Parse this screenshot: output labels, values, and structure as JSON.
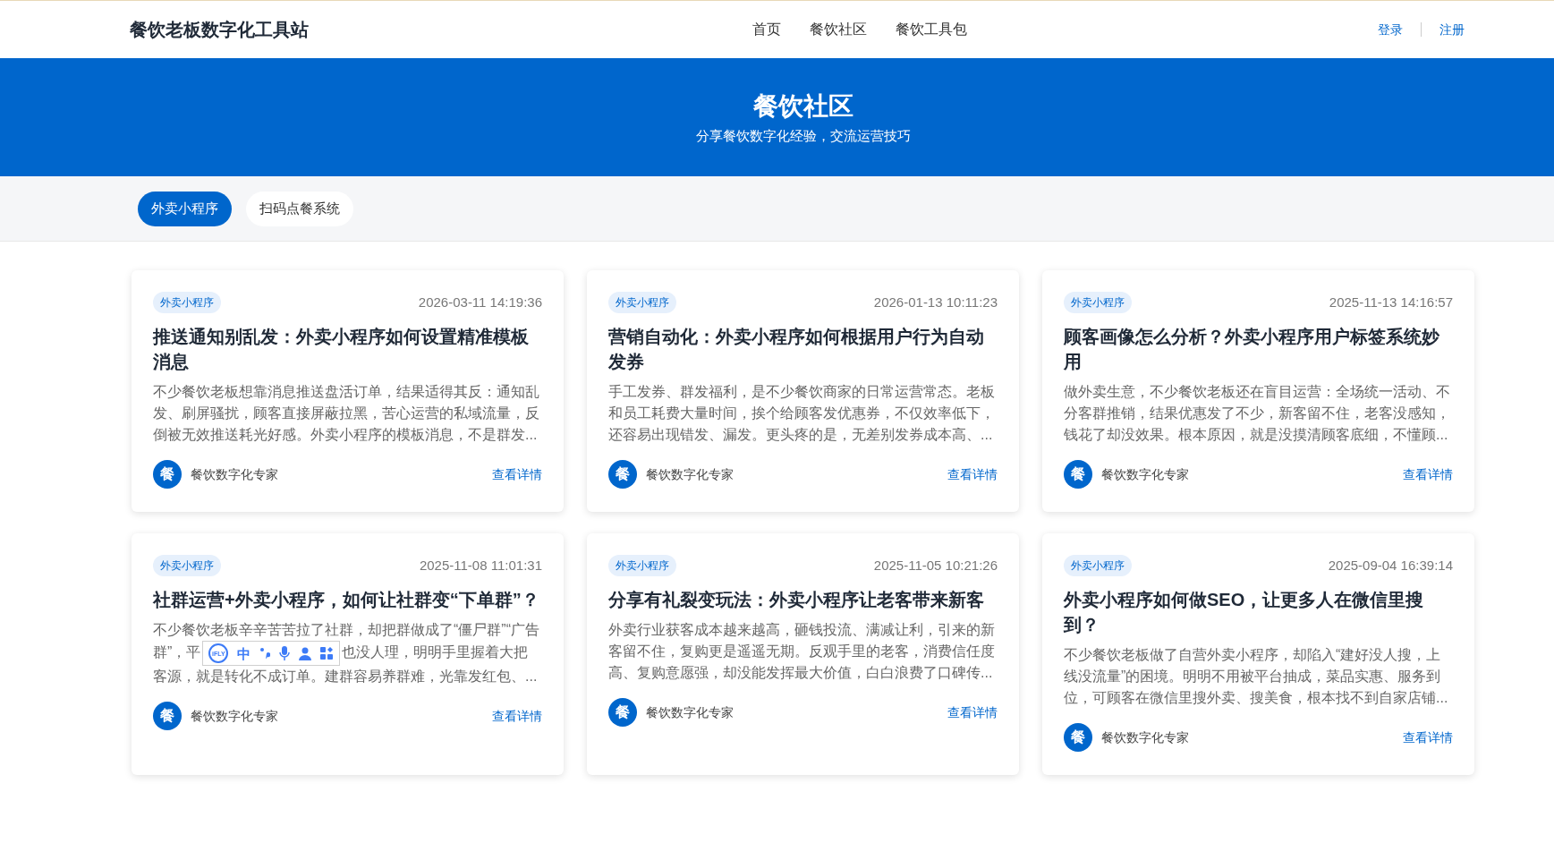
{
  "header": {
    "logo": "餐饮老板数字化工具站",
    "nav": [
      {
        "label": "首页",
        "selected": false
      },
      {
        "label": "餐饮社区",
        "selected": false
      },
      {
        "label": "餐饮工具包",
        "selected": false
      }
    ],
    "auth": [
      "登录",
      "注册"
    ]
  },
  "hero": {
    "title": "餐饮社区",
    "subtitle": "分享餐饮数字化经验，交流运营技巧"
  },
  "filters": [
    {
      "label": "外卖小程序",
      "selected": true
    },
    {
      "label": "扫码点餐系统",
      "selected": false
    }
  ],
  "articles": [
    {
      "tag": "外卖小程序",
      "date": "2026-03-11 14:19:36",
      "title": "推送通知别乱发：外卖小程序如何设置精准模板消息",
      "excerpt": [
        "不少餐饮老板想靠消息推送盘活订单，结果适得其反：通知乱发、刷屏骚扰，顾客直接屏蔽拉黑，苦心运营的私域流量，反倒被无效推送耗光好感。外卖小程序的模板消息，不是群发..."
      ],
      "avatar": "餐",
      "author": "餐饮数字化专家",
      "link": "查看详情"
    },
    {
      "tag": "外卖小程序",
      "date": "2026-01-13 10:11:23",
      "title": "营销自动化：外卖小程序如何根据用户行为自动发券",
      "excerpt": [
        "手工发券、群发福利，是不少餐饮商家的日常运营常态。老板和员工耗费大量时间，挨个给顾客发优惠券，不仅效率低下，还容易出现错发、漏发。更头疼的是，无差别发券成本高、..."
      ],
      "avatar": "餐",
      "author": "餐饮数字化专家",
      "link": "查看详情"
    },
    {
      "tag": "外卖小程序",
      "date": "2025-11-13 14:16:57",
      "title": "顾客画像怎么分析？外卖小程序用户标签系统妙用",
      "excerpt": [
        "做外卖生意，不少餐饮老板还在盲目运营：全场统一活动、不分客群推销，结果优惠发了不少，新客留不住，老客没感知，钱花了却没效果。根本原因，就是没摸清顾客底细，不懂顾..."
      ],
      "avatar": "餐",
      "author": "餐饮数字化专家",
      "link": "查看详情"
    },
    {
      "tag": "外卖小程序",
      "date": "2025-11-08 11:01:31",
      "title": "社群运营+外卖小程序，如何让社群变“下单群”？",
      "excerpt": [
        "不少餐饮老板辛辛苦苦拉了社群，却把群做成了“僵尸群”“广告群”，平",
        "也没人理，明明手里握着大把客源，就是转化不成订单。建群容易养群难，光靠发红包、..."
      ],
      "avatar": "餐",
      "author": "餐饮数字化专家",
      "link": "查看详情",
      "ime_toolbar": {
        "logo": "iFLY",
        "mode": "中"
      }
    },
    {
      "tag": "外卖小程序",
      "date": "2025-11-05 10:21:26",
      "title": "分享有礼裂变玩法：外卖小程序让老客带来新客",
      "excerpt": [
        "外卖行业获客成本越来越高，砸钱投流、满减让利，引来的新客留不住，复购更是遥遥无期。反观手里的老客，消费信任度高、复购意愿强，却没能发挥最大价值，白白浪费了口碑传..."
      ],
      "avatar": "餐",
      "author": "餐饮数字化专家",
      "link": "查看详情"
    },
    {
      "tag": "外卖小程序",
      "date": "2025-09-04 16:39:14",
      "title": "外卖小程序如何做SEO，让更多人在微信里搜到？",
      "excerpt": [
        "不少餐饮老板做了自营外卖小程序，却陷入“建好没人搜，上线没流量”的困境。明明不用被平台抽成，菜品实惠、服务到位，可顾客在微信里搜外卖、搜美食，根本找不到自家店铺..."
      ],
      "avatar": "餐",
      "author": "餐饮数字化专家",
      "link": "查看详情"
    }
  ]
}
